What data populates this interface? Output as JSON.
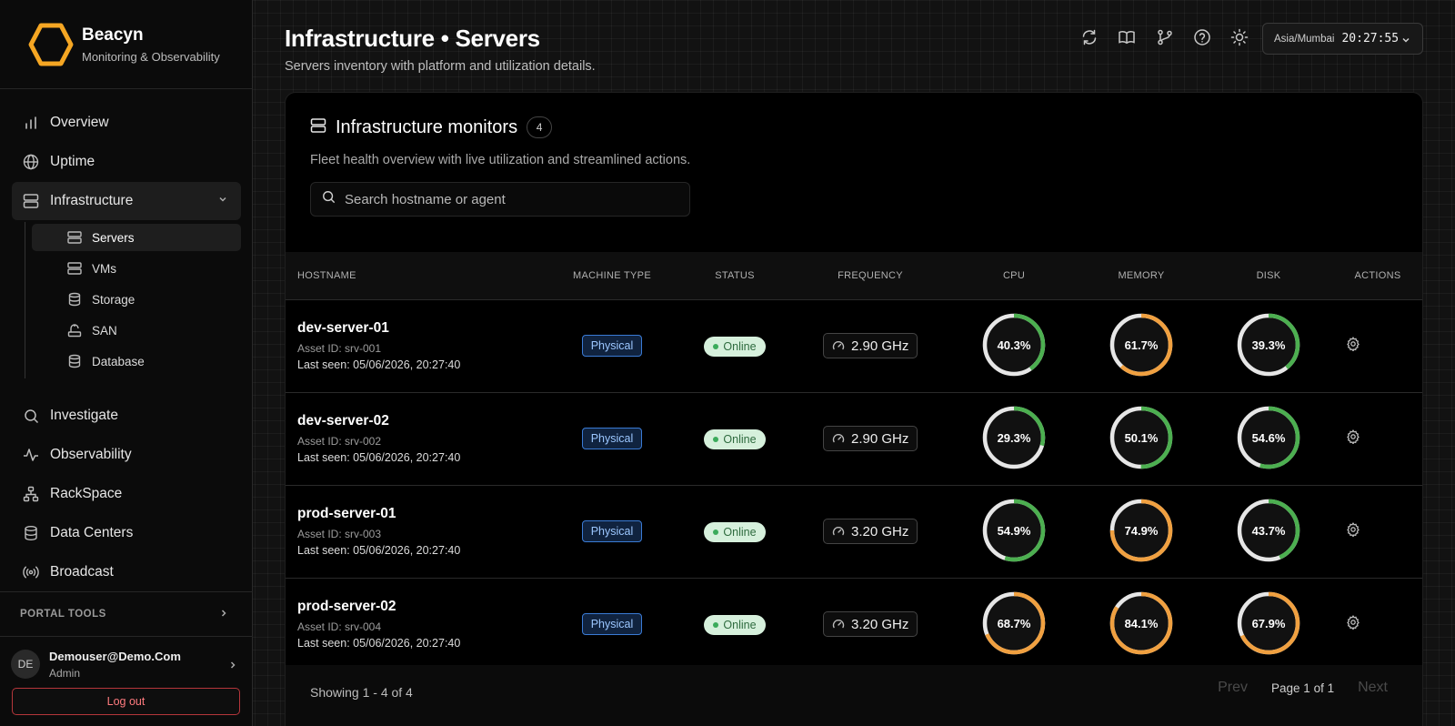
{
  "app": {
    "name": "Beacyn",
    "tagline": "Monitoring & Observability",
    "accent": "#f5a623"
  },
  "sidebar": {
    "items": [
      {
        "label": "Overview",
        "icon": "bar-chart-icon"
      },
      {
        "label": "Uptime",
        "icon": "globe-icon"
      },
      {
        "label": "Infrastructure",
        "icon": "server-icon",
        "active": true,
        "expanded": true
      },
      {
        "label": "Investigate",
        "icon": "search-icon"
      },
      {
        "label": "Observability",
        "icon": "activity-icon"
      },
      {
        "label": "RackSpace",
        "icon": "network-icon"
      },
      {
        "label": "Data Centers",
        "icon": "database-icon"
      },
      {
        "label": "Broadcast",
        "icon": "broadcast-icon"
      }
    ],
    "infrastructure_children": [
      {
        "label": "Servers",
        "icon": "server-icon",
        "active": true
      },
      {
        "label": "VMs",
        "icon": "server-icon"
      },
      {
        "label": "Storage",
        "icon": "database-icon"
      },
      {
        "label": "SAN",
        "icon": "san-icon"
      },
      {
        "label": "Database",
        "icon": "database-icon"
      }
    ],
    "portal_tools": "PORTAL TOOLS",
    "user": {
      "initials": "DE",
      "name": "Demouser@Demo.Com",
      "role": "Admin"
    },
    "logout": "Log out"
  },
  "header": {
    "title": "Infrastructure • Servers",
    "subtitle": "Servers inventory with platform and utilization details.",
    "icons": [
      "refresh-icon",
      "book-icon",
      "git-branch-icon",
      "help-icon",
      "sun-icon"
    ],
    "timezone": "Asia/Mumbai",
    "time": "20:27:55"
  },
  "panel": {
    "title": "Infrastructure monitors",
    "count": "4",
    "subtitle": "Fleet health overview with live utilization and streamlined actions.",
    "search_placeholder": "Search hostname or agent",
    "columns": [
      "HOSTNAME",
      "MACHINE TYPE",
      "STATUS",
      "FREQUENCY",
      "CPU",
      "MEMORY",
      "DISK",
      "ACTIONS"
    ],
    "rows": [
      {
        "host": "dev-server-01",
        "asset": "Asset ID: srv-001",
        "seen": "Last seen: 05/06/2026, 20:27:40",
        "type": "Physical",
        "status": "Online",
        "freq": "2.90 GHz",
        "cpu": 40.3,
        "cpu_label": "40.3%",
        "mem": 61.7,
        "mem_label": "61.7%",
        "disk": 39.3,
        "disk_label": "39.3%"
      },
      {
        "host": "dev-server-02",
        "asset": "Asset ID: srv-002",
        "seen": "Last seen: 05/06/2026, 20:27:40",
        "type": "Physical",
        "status": "Online",
        "freq": "2.90 GHz",
        "cpu": 29.3,
        "cpu_label": "29.3%",
        "mem": 50.1,
        "mem_label": "50.1%",
        "disk": 54.6,
        "disk_label": "54.6%"
      },
      {
        "host": "prod-server-01",
        "asset": "Asset ID: srv-003",
        "seen": "Last seen: 05/06/2026, 20:27:40",
        "type": "Physical",
        "status": "Online",
        "freq": "3.20 GHz",
        "cpu": 54.9,
        "cpu_label": "54.9%",
        "mem": 74.9,
        "mem_label": "74.9%",
        "disk": 43.7,
        "disk_label": "43.7%"
      },
      {
        "host": "prod-server-02",
        "asset": "Asset ID: srv-004",
        "seen": "Last seen: 05/06/2026, 20:27:40",
        "type": "Physical",
        "status": "Online",
        "freq": "3.20 GHz",
        "cpu": 68.7,
        "cpu_label": "68.7%",
        "mem": 84.1,
        "mem_label": "84.1%",
        "disk": 67.9,
        "disk_label": "67.9%"
      }
    ],
    "footer": {
      "showing": "Showing 1 - 4 of 4",
      "prev": "Prev",
      "page": "Page 1 of 1",
      "next": "Next"
    }
  },
  "colors": {
    "gauge_ok": "#4caf50",
    "gauge_warn": "#f0a040",
    "gauge_track": "#e6e6e6",
    "online": "#3bab5b"
  }
}
